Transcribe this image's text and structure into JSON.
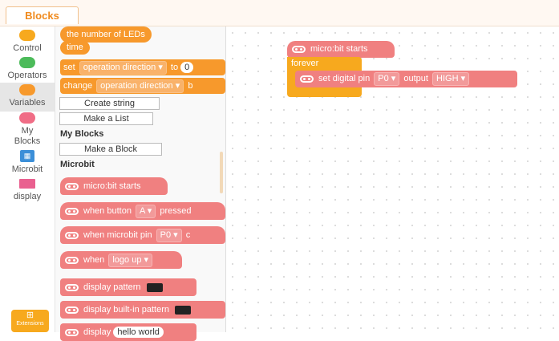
{
  "header": {
    "tab_label": "Blocks"
  },
  "categories": [
    {
      "label": "Control",
      "color": "#f7a91e"
    },
    {
      "label": "Operators",
      "color": "#4cbb5a"
    },
    {
      "label": "Variables",
      "color": "#f7992c"
    },
    {
      "label": "My Blocks",
      "color": "#f06d86"
    },
    {
      "label": "Microbit",
      "icon": "microbit-icon"
    },
    {
      "label": "display",
      "icon": "display-icon"
    }
  ],
  "extensions_label": "Extensions",
  "palette": {
    "var_number_leds": "the number of LEDs",
    "var_time": "time",
    "set_kw": "set",
    "set_var": "operation direction",
    "set_to": "to",
    "set_value": "0",
    "change_kw": "change",
    "change_var": "operation direction",
    "change_by": "b",
    "create_string": "Create string",
    "make_list": "Make a List",
    "my_blocks_heading": "My Blocks",
    "make_block": "Make a Block",
    "microbit_heading": "Microbit",
    "mb_starts": "micro:bit starts",
    "when_button": "when button",
    "button_val": "A",
    "pressed": "pressed",
    "when_pin": "when microbit pin",
    "pin_val": "P0",
    "pin_tail": "c",
    "when_kw": "when",
    "logo_val": "logo up",
    "display_pattern": "display pattern",
    "display_builtin": "display built-in pattern",
    "display_kw": "display",
    "display_text": "hello world"
  },
  "canvas": {
    "hat_label": "micro:bit starts",
    "forever_label": "forever",
    "set_pin_label": "set digital pin",
    "pin_val": "P0",
    "output_label": "output",
    "level_val": "HIGH"
  },
  "colors": {
    "accent": "#f08a1d",
    "control": "#f7a91e",
    "variables": "#f7992c",
    "microbit_blocks": "#f08080"
  }
}
